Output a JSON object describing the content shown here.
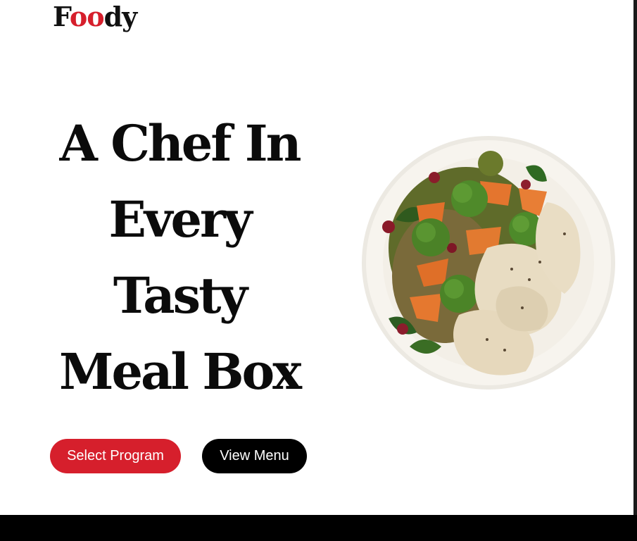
{
  "brand": {
    "logo_first": "F",
    "logo_accent": "oo",
    "logo_last": "dy",
    "accent_color": "#d61f2c"
  },
  "hero": {
    "title_lines": [
      "A Chef In",
      "Every",
      "Tasty",
      "Meal Box"
    ]
  },
  "actions": {
    "primary_label": "Select Program",
    "secondary_label": "View Menu",
    "primary_color": "#d61f2c",
    "secondary_color": "#000000"
  },
  "image": {
    "icon": "meal-plate-image"
  }
}
